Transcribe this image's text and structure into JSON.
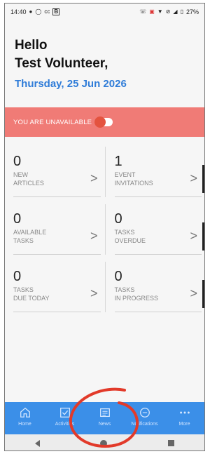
{
  "status_bar": {
    "time": "14:40",
    "left_icons": [
      "whatsapp-icon",
      "whatsapp-icon",
      "cc-icon",
      "b-icon"
    ],
    "right_icons": [
      "call-icon",
      "data-icon",
      "wifi-icon",
      "dnd-icon",
      "signal-icon",
      "battery-icon"
    ],
    "battery": "27%"
  },
  "greeting": {
    "hello": "Hello",
    "name": "Test Volunteer,",
    "date": "Thursday, 25 Jun 2026"
  },
  "availability": {
    "label": "YOU ARE UNAVAILABLE",
    "toggle_on": false,
    "banner_color": "#f07b76"
  },
  "tiles": [
    {
      "count": "0",
      "line1": "NEW",
      "line2": "ARTICLES"
    },
    {
      "count": "1",
      "line1": "EVENT",
      "line2": "INVITATIONS"
    },
    {
      "count": "0",
      "line1": "AVAILABLE",
      "line2": "TASKS"
    },
    {
      "count": "0",
      "line1": "TASKS",
      "line2": "OVERDUE"
    },
    {
      "count": "0",
      "line1": "TASKS",
      "line2": "DUE TODAY"
    },
    {
      "count": "0",
      "line1": "TASKS",
      "line2": "IN PROGRESS"
    }
  ],
  "bottom_nav": {
    "color": "#3b8fe8",
    "items": [
      {
        "label": "Home",
        "icon": "home-icon"
      },
      {
        "label": "Activities",
        "icon": "checklist-icon"
      },
      {
        "label": "News",
        "icon": "news-icon"
      },
      {
        "label": "Notifications",
        "icon": "notification-icon"
      },
      {
        "label": "More",
        "icon": "more-icon"
      }
    ]
  },
  "accent_color": "#2f7cd8"
}
